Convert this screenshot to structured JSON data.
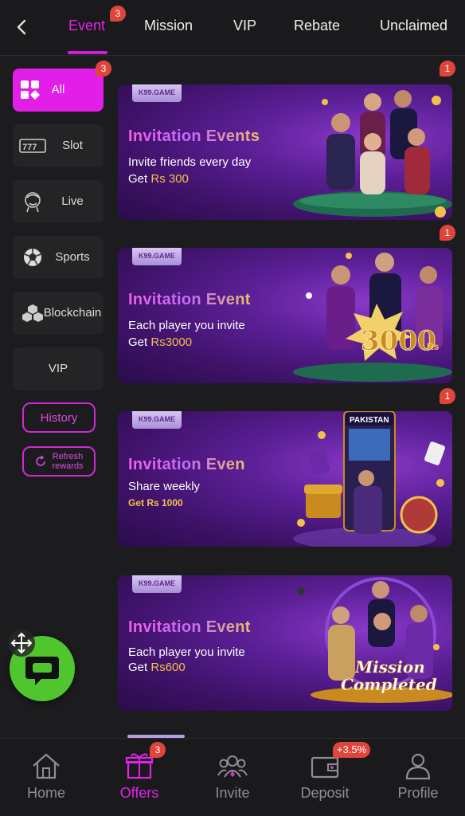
{
  "header": {
    "tabs": [
      {
        "label": "Event",
        "badge": "3"
      },
      {
        "label": "Mission"
      },
      {
        "label": "VIP"
      },
      {
        "label": "Rebate"
      },
      {
        "label": "Unclaimed"
      }
    ]
  },
  "sidebar": {
    "all_badge": "3",
    "items": [
      {
        "label": "All",
        "icon": "grid-icon"
      },
      {
        "label": "Slot",
        "icon": "slot-777-icon"
      },
      {
        "label": "Live",
        "icon": "live-dealer-icon"
      },
      {
        "label": "Sports",
        "icon": "soccer-ball-icon"
      },
      {
        "label": "Blockchain",
        "icon": "blockchain-cubes-icon"
      },
      {
        "label": "VIP"
      }
    ],
    "history_label": "History",
    "refresh_label_1": "Refresh",
    "refresh_label_2": "rewards"
  },
  "banners": [
    {
      "brand": "K99.GAME",
      "title": "Invitation Events",
      "line1": "Invite friends every day",
      "amount_prefix": "Get ",
      "amount": "Rs 300",
      "badge": "1"
    },
    {
      "brand": "K99.GAME",
      "title": "Invitation Event",
      "line1": "Each player you invite",
      "amount_prefix": "Get ",
      "amount": "Rs3000",
      "art_text": "3000",
      "art_sub": "Rs",
      "badge": "1"
    },
    {
      "brand": "K99.GAME",
      "title": "Invitation Even",
      "line1": "Share weekly",
      "amount_prefix": "",
      "amount": "Get Rs 1000",
      "art_text": "PAKISTAN",
      "badge": "1"
    },
    {
      "brand": "K99.GAME",
      "title": "Invitation Event",
      "line1": "Each player you invite",
      "amount_prefix": "Get ",
      "amount": "Rs600",
      "art_text": "Mission",
      "art_sub": "Completed"
    }
  ],
  "bottom_nav": {
    "items": [
      {
        "label": "Home"
      },
      {
        "label": "Offers",
        "badge": "3"
      },
      {
        "label": "Invite"
      },
      {
        "label": "Deposit",
        "badge": "+3.5%"
      },
      {
        "label": "Profile"
      }
    ]
  },
  "colors": {
    "accent": "#e223e6",
    "badge": "#e0453c",
    "fab": "#4fc62d",
    "banner": "#5b1f96"
  }
}
